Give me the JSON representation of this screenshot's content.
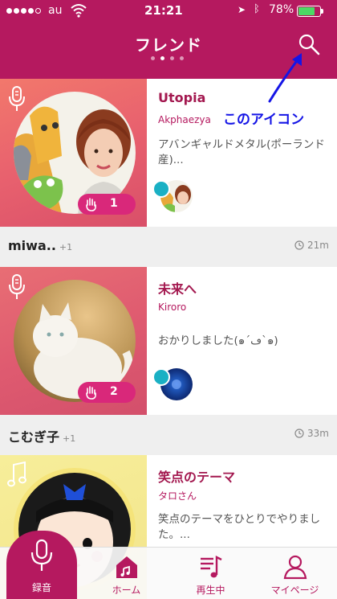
{
  "status_bar": {
    "carrier": "au",
    "time": "21:21",
    "battery": "78%",
    "battery_level": 0.78
  },
  "header": {
    "title": "フレンド",
    "page_count": 4,
    "active_page": 1,
    "search_icon": "search-icon"
  },
  "annotation": {
    "text": "このアイコン",
    "color": "#1515e6"
  },
  "feed": [
    {
      "title": "Utopia",
      "author": "Akphaezya",
      "description": "アバンギャルドメタル(ポーランド産)...",
      "claps": "1",
      "type_icon": "microphone-icon",
      "user": "miwa..",
      "plus": "+1",
      "time": "21m"
    },
    {
      "title": "未来へ",
      "author": "Kiroro",
      "description": "おかりしました(๑´ڡ`๑)",
      "claps": "2",
      "type_icon": "microphone-icon",
      "user": "こむぎ子",
      "plus": "+1",
      "time": "33m"
    },
    {
      "title": "笑点のテーマ",
      "author": "タロさん",
      "description": "笑点のテーマをひとりでやりました。...",
      "type_icon": "music-note-icon"
    }
  ],
  "tabbar": {
    "record": "録音",
    "home": "ホーム",
    "playing": "再生中",
    "mypage": "マイページ"
  },
  "colors": {
    "brand": "#b5195f",
    "clap_badge": "#d9287a",
    "background": "#efefef"
  }
}
